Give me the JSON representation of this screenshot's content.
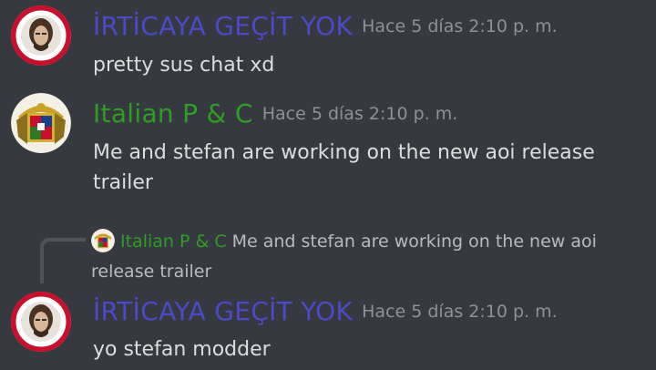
{
  "colors": {
    "background": "#36393f",
    "user_turkish": "#4b4bc9",
    "user_italian": "#2f9e23",
    "timestamp": "#8e9297",
    "text": "#dcddde"
  },
  "messages": [
    {
      "author": "İRTİCAYA GEÇİT YOK",
      "timestamp": "Hace 5 días 2:10 p. m.",
      "lines": [
        "pretty sus chat xd"
      ],
      "avatar_icon": "turkish-emblem-avatar"
    },
    {
      "author": "Italian P & C",
      "timestamp": "Hace 5 días 2:10 p. m.",
      "lines": [
        "Me and stefan are working on the new aoi release",
        "trailer"
      ],
      "avatar_icon": "italian-coat-of-arms-avatar"
    },
    {
      "author": "İRTİCAYA GEÇİT YOK",
      "timestamp": "Hace 5 días 2:10 p. m.",
      "lines": [
        "yo stefan modder"
      ],
      "avatar_icon": "turkish-emblem-avatar",
      "reply_to": {
        "author": "Italian P & C",
        "text_line1": "Me and stefan are working on the new aoi",
        "text_line2": "release trailer"
      }
    }
  ]
}
